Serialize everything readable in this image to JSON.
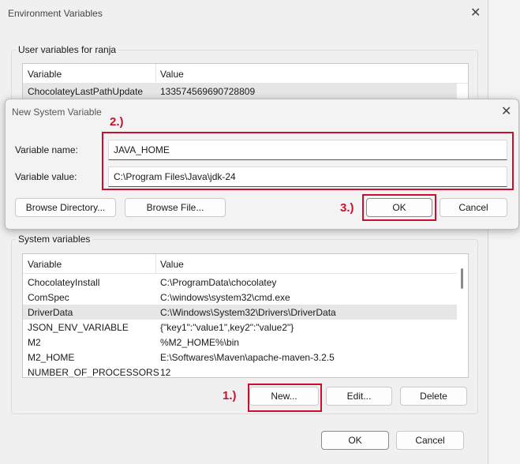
{
  "env_window": {
    "title": "Environment Variables",
    "user_section_label": "User variables for ranja",
    "user_columns": [
      "Variable",
      "Value"
    ],
    "user_rows": [
      {
        "variable": "ChocolateyLastPathUpdate",
        "value": "133574569690728809"
      }
    ],
    "system_section_label": "System variables",
    "system_columns": [
      "Variable",
      "Value"
    ],
    "system_rows": [
      {
        "variable": "ChocolateyInstall",
        "value": "C:\\ProgramData\\chocolatey"
      },
      {
        "variable": "ComSpec",
        "value": "C:\\windows\\system32\\cmd.exe"
      },
      {
        "variable": "DriverData",
        "value": "C:\\Windows\\System32\\Drivers\\DriverData"
      },
      {
        "variable": "JSON_ENV_VARIABLE",
        "value": "{\"key1\":\"value1\",key2\":\"value2\"}"
      },
      {
        "variable": "M2",
        "value": "%M2_HOME%\\bin"
      },
      {
        "variable": "M2_HOME",
        "value": "E:\\Softwares\\Maven\\apache-maven-3.2.5"
      },
      {
        "variable": "NUMBER_OF_PROCESSORS",
        "value": "12"
      }
    ],
    "system_buttons": {
      "new": "New...",
      "edit": "Edit...",
      "delete": "Delete"
    },
    "ok": "OK",
    "cancel": "Cancel",
    "close_icon": "close-icon"
  },
  "new_var_dialog": {
    "title": "New System Variable",
    "name_label": "Variable name:",
    "name_value": "JAVA_HOME",
    "value_label": "Variable value:",
    "value_value": "C:\\Program Files\\Java\\jdk-24",
    "browse_directory": "Browse Directory...",
    "browse_file": "Browse File...",
    "ok": "OK",
    "cancel": "Cancel"
  },
  "annotations": {
    "step1": "1.)",
    "step2": "2.)",
    "step3": "3.)",
    "color": "#c8102e"
  }
}
